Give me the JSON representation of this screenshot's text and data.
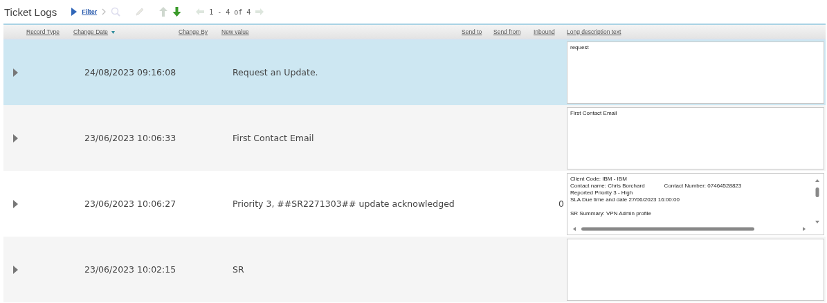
{
  "title": "Ticket Logs",
  "toolbar": {
    "filter_label": "Filter",
    "tools": [
      {
        "kind": "chevron",
        "disabled": true
      },
      {
        "kind": "search",
        "disabled": true
      },
      {
        "kind": "edit",
        "disabled": true
      },
      {
        "kind": "up",
        "disabled": true
      },
      {
        "kind": "down",
        "disabled": false
      }
    ],
    "pager": {
      "prev_disabled": true,
      "text": "1 - 4 of 4",
      "next_disabled": true
    }
  },
  "columns": [
    {
      "label": "Record Type"
    },
    {
      "label": "Change Date",
      "sorted": true
    },
    {
      "label": "Change By"
    },
    {
      "label": "New value"
    },
    {
      "label": "Send to"
    },
    {
      "label": "Send from"
    },
    {
      "label": "Inbound"
    },
    {
      "label": "Long description text"
    }
  ],
  "rows": [
    {
      "selected": true,
      "change_date": "24/08/2023 09:16:08",
      "new_value": "Request an Update.",
      "long_description": {
        "scrollbars": false,
        "lines": [
          {
            "parts": [
              "request"
            ]
          }
        ]
      }
    },
    {
      "selected": false,
      "change_date": "23/06/2023 10:06:33",
      "new_value": "First Contact Email",
      "long_description": {
        "scrollbars": false,
        "lines": [
          {
            "parts": [
              "First Contact Email"
            ]
          }
        ]
      }
    },
    {
      "selected": false,
      "change_date": "23/06/2023 10:06:27",
      "new_value": "Priority 3, ##SR2271303## update acknowledged",
      "inbound": "0",
      "long_description": {
        "scrollbars": true,
        "lines": [
          {
            "parts": [
              "Client Code: IBM - IBM"
            ]
          },
          {
            "parts": [
              "Contact name: Chris Borchard",
              "Contact Number: 07464528823"
            ]
          },
          {
            "parts": [
              "Reported Priority 3 - High"
            ]
          },
          {
            "parts": [
              "SLA Due time and date 27/06/2023 16:00:00"
            ]
          },
          {
            "kind": "blank"
          },
          {
            "parts": [
              "SR Summary: VPN Admin profile"
            ]
          }
        ]
      }
    },
    {
      "selected": false,
      "change_date": "23/06/2023 10:02:15",
      "new_value": "SR",
      "long_description": {
        "scrollbars": false
      }
    }
  ]
}
